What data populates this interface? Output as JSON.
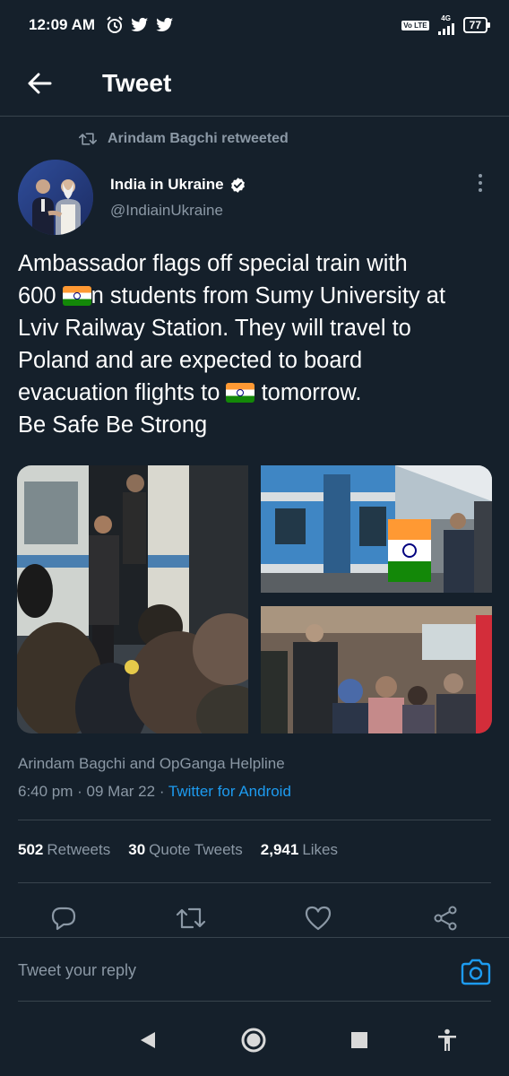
{
  "status_bar": {
    "time": "12:09 AM",
    "network": "4G",
    "volte": "Vo LTE",
    "battery": "77",
    "icons": [
      "alarm-icon",
      "twitter-bird-icon",
      "twitter-bird-icon",
      "signal-icon",
      "battery-icon"
    ]
  },
  "header": {
    "title": "Tweet",
    "back_icon": "arrow-left-icon"
  },
  "retweeted_by": "Arindam Bagchi retweeted",
  "author": {
    "name": "India in Ukraine",
    "handle": "@IndiainUkraine",
    "verified": true
  },
  "tweet": {
    "lines": [
      "Ambassador flags off special train with",
      "600 ",
      "n students from Sumy University at",
      "Lviv Railway Station. They will travel to",
      "Poland and are expected to board",
      "evacuation flights to ",
      " tomorrow.",
      "Be Safe Be Strong"
    ],
    "emoji": "flag-india"
  },
  "media_count": 3,
  "attribution": "Arindam Bagchi and OpGanga Helpline",
  "meta": {
    "time": "6:40 pm",
    "separator": " · ",
    "date": "09 Mar 22",
    "source": "Twitter for Android"
  },
  "stats": {
    "retweets": "502",
    "retweets_label": "Retweets",
    "quotes": "30",
    "quotes_label": "Quote Tweets",
    "likes": "2,941",
    "likes_label": "Likes"
  },
  "reply": {
    "placeholder": "Tweet your reply"
  },
  "colors": {
    "background": "#15202b",
    "divider": "#38444d",
    "secondary_text": "#8b98a5",
    "accent": "#1d9bf0"
  }
}
